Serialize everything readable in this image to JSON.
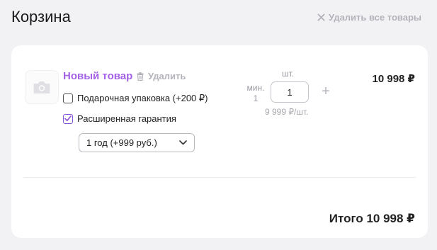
{
  "header": {
    "title": "Корзина",
    "clear_all_label": "Удалить все товары"
  },
  "item": {
    "name": "Новый товар",
    "remove_label": "Удалить",
    "options": {
      "gift_wrap": {
        "label": "Подарочная упаковка (+200 ₽)",
        "checked": false
      },
      "warranty": {
        "label": "Расширенная гарантия",
        "checked": true
      }
    },
    "warranty_select": {
      "selected": "1 год (+999 руб.)"
    },
    "quantity": {
      "unit": "шт.",
      "min_label": "мин.",
      "min_value": "1",
      "value": "1",
      "plus": "+"
    },
    "unit_price": "9 999 ₽/шт.",
    "line_price": "10 998 ₽"
  },
  "summary": {
    "total": "Итого 10 998 ₽"
  },
  "colors": {
    "accent": "#a362e6",
    "muted": "#b3b3bb",
    "background": "#f2f2f4",
    "card": "#ffffff"
  },
  "icons": {
    "clear_all": "close-icon",
    "thumbnail": "camera-icon",
    "remove": "trash-icon",
    "select": "chevron-down-icon",
    "check": "checkmark-icon"
  }
}
